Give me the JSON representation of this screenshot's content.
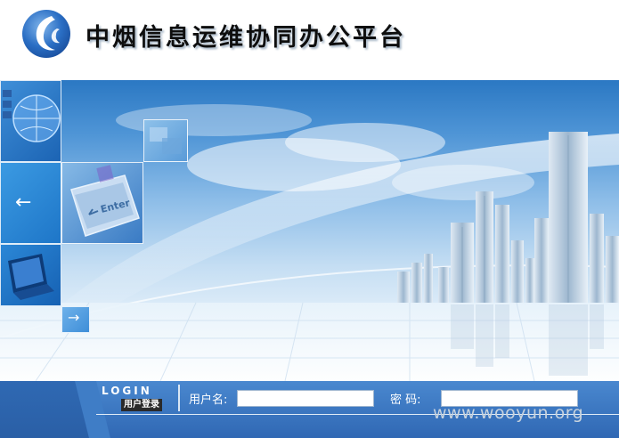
{
  "header": {
    "title": "中烟信息运维协同办公平台",
    "logo_icon": "tobacco-flame-logo"
  },
  "banner": {
    "tiles_icons": [
      "globe-keyboard-icon",
      "arrow-left-icon",
      "enter-key-icon",
      "monitor-icon",
      "tile-image-icon",
      "arrow-right-icon"
    ],
    "arrow_left_glyph": "←",
    "arrow_right_glyph": "→"
  },
  "login": {
    "word": "LOGIN",
    "badge": "用户登录",
    "username_label": "用户名:",
    "username_value": "",
    "password_label": "密  码:",
    "password_value": ""
  },
  "watermark": "www.wooyun.org",
  "colors": {
    "header_bg": "#ffffff",
    "bar_blue": "#3b76c0",
    "sky_top": "#2b78c3",
    "sky_bottom": "#eef6fc"
  }
}
